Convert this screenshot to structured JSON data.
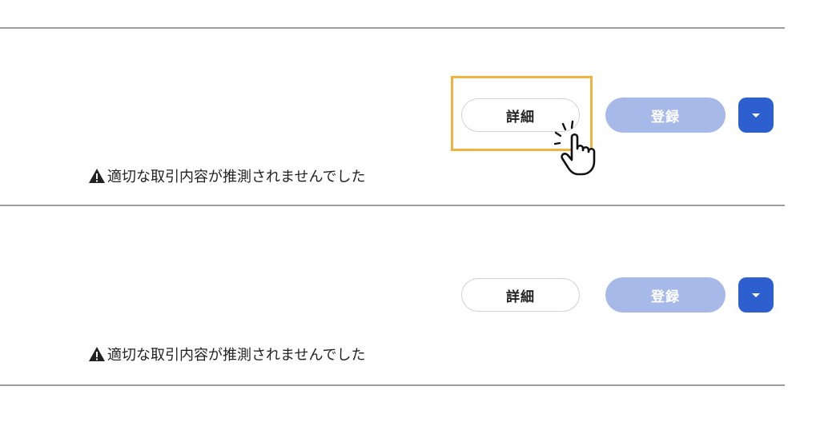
{
  "rows": [
    {
      "detail_label": "詳細",
      "register_label": "登録",
      "warning_text": "適切な取引内容が推測されませんでした"
    },
    {
      "detail_label": "詳細",
      "register_label": "登録",
      "warning_text": "適切な取引内容が推測されませんでした"
    }
  ],
  "icons": {
    "warning": "warning-triangle-icon",
    "dropdown": "chevron-down-icon",
    "cursor": "pointing-hand-cursor-icon"
  },
  "colors": {
    "highlight": "#f0b341",
    "register_disabled": "#a7b9e8",
    "dropdown_bg": "#2d5fcf",
    "divider": "#9e9e9e"
  }
}
